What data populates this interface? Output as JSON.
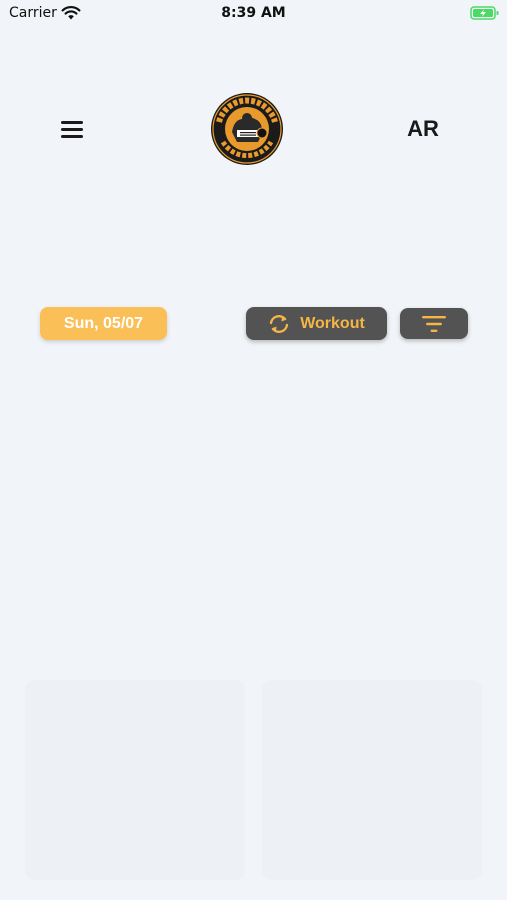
{
  "status_bar": {
    "carrier": "Carrier",
    "time": "8:39 AM"
  },
  "header": {
    "menu_icon": "hamburger-menu-icon",
    "logo_icon": "evolution-center-logo",
    "language_toggle": "AR"
  },
  "toolbar": {
    "date": "Sun, 05/07",
    "workout_label": "Workout",
    "workout_icon": "refresh-icon",
    "filter_icon": "filter-icon"
  },
  "colors": {
    "background": "#f1f4f8",
    "accent": "#fbbf57",
    "dark_button": "#535353",
    "button_text": "#f6b545",
    "battery": "#4cd964"
  }
}
